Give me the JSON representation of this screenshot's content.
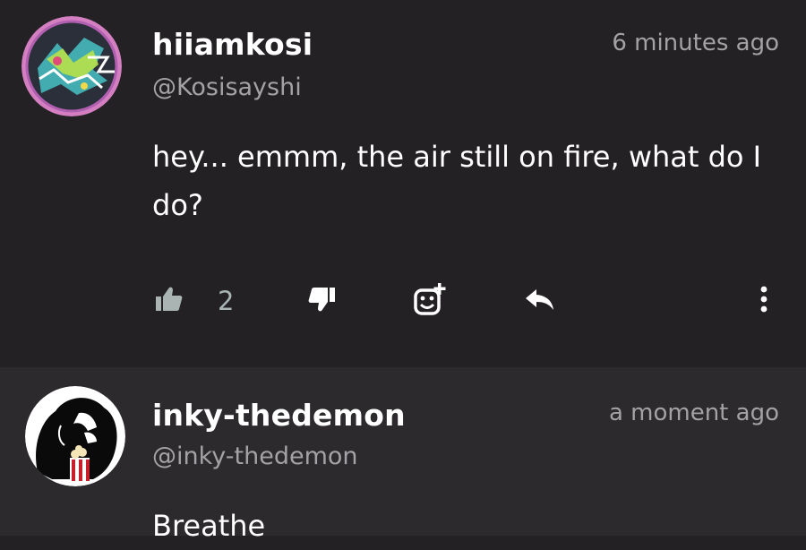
{
  "comments": [
    {
      "username": "hiiamkosi",
      "handle": "@Kosisayshi",
      "time": "6 minutes ago",
      "text": "hey... emmm, the air still on fire, what do I do?",
      "likes": "2",
      "icons": [
        "thumbs-up-icon",
        "thumbs-down-icon",
        "add-emoji-icon",
        "reply-icon",
        "more-icon"
      ]
    },
    {
      "username": "inky-thedemon",
      "handle": "@inky-thedemon",
      "time": "a moment ago",
      "text": "Breathe"
    }
  ],
  "colors": {
    "background": "#232124",
    "second_comment_background": "#2c2a2d",
    "muted_text": "#a3a2a4",
    "like_color": "#a9b4b3"
  }
}
